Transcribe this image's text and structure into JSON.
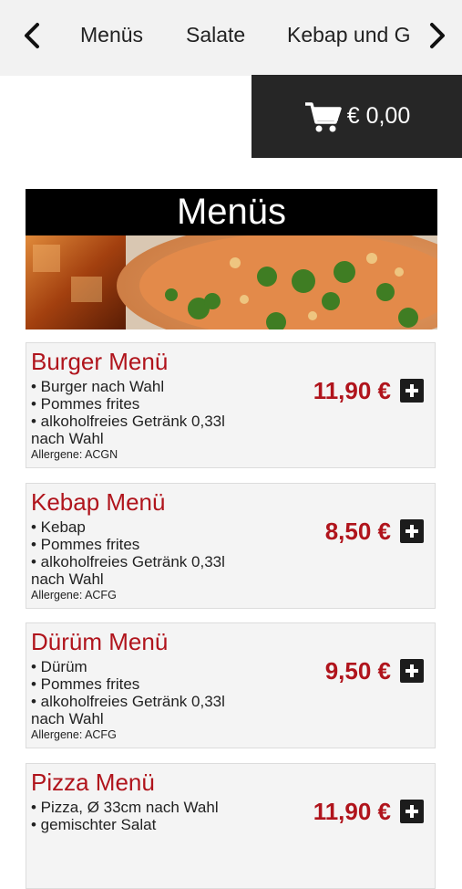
{
  "nav": {
    "items": [
      "Menüs",
      "Salate",
      "Kebap und G"
    ]
  },
  "cart": {
    "total": "€ 0,00"
  },
  "category": {
    "title": "Menüs"
  },
  "colors": {
    "accent": "#b0141c",
    "header_bg": "#000000",
    "cart_bg": "#262626"
  },
  "items": [
    {
      "title": "Burger Menü",
      "lines": [
        "• Burger nach Wahl",
        "• Pommes frites",
        "• alkoholfreies Getränk 0,33l",
        "nach Wahl"
      ],
      "allergens": "Allergene: ACGN",
      "price": "11,90 €"
    },
    {
      "title": "Kebap Menü",
      "lines": [
        "• Kebap",
        "• Pommes frites",
        "• alkoholfreies Getränk 0,33l",
        "nach Wahl"
      ],
      "allergens": "Allergene: ACFG",
      "price": "8,50 €"
    },
    {
      "title": "Dürüm Menü",
      "lines": [
        "• Dürüm",
        "• Pommes frites",
        "• alkoholfreies Getränk 0,33l",
        "nach Wahl"
      ],
      "allergens": "Allergene: ACFG",
      "price": "9,50 €"
    },
    {
      "title": "Pizza Menü",
      "lines": [
        "• Pizza, Ø 33cm nach Wahl",
        "• gemischter Salat"
      ],
      "allergens": "",
      "price": "11,90 €"
    }
  ]
}
